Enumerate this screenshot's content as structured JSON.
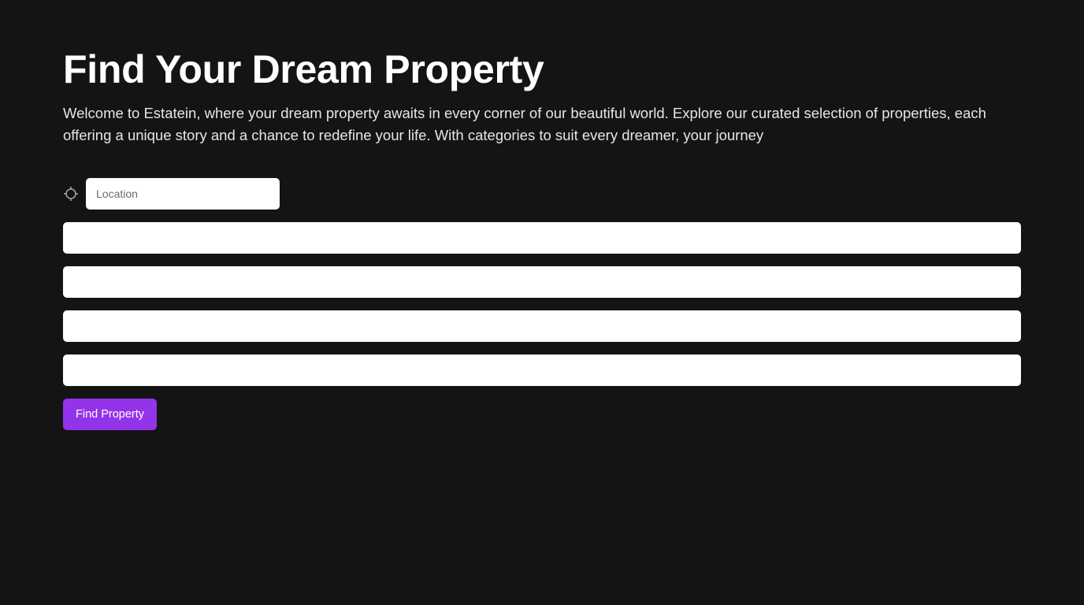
{
  "hero": {
    "title": "Find Your Dream Property",
    "description": "Welcome to Estatein, where your dream property awaits in every corner of our beautiful world. Explore our curated selection of properties, each offering a unique story and a chance to redefine your life. With categories to suit every dreamer, your journey"
  },
  "form": {
    "location": {
      "icon": "crosshair-icon",
      "placeholder": "Location",
      "value": ""
    },
    "fields": [
      {
        "value": "",
        "placeholder": ""
      },
      {
        "value": "",
        "placeholder": ""
      },
      {
        "value": "",
        "placeholder": ""
      },
      {
        "value": "",
        "placeholder": ""
      }
    ],
    "submit_label": "Find Property"
  },
  "colors": {
    "background": "#141414",
    "accent": "#9333ea",
    "text": "#ffffff",
    "input_background": "#ffffff",
    "icon": "#9ca3af"
  }
}
